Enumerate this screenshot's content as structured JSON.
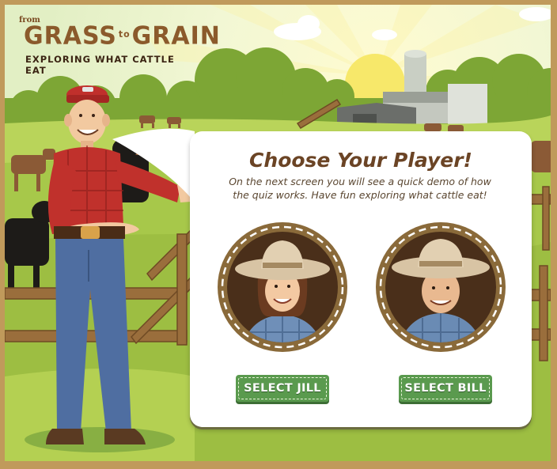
{
  "logo": {
    "from": "from",
    "word1": "GRASS",
    "to": "to",
    "word2": "GRAIN",
    "tagline": "Exploring What Cattle Eat"
  },
  "dialog": {
    "title": "Choose Your Player!",
    "description": "On the next screen you will see a quick demo of how the quiz works. Have fun exploring what cattle eat!"
  },
  "players": [
    {
      "name": "Jill",
      "button_label": "SELECT JILL"
    },
    {
      "name": "Bill",
      "button_label": "SELECT BILL"
    }
  ],
  "colors": {
    "sky": "#f4f8d8",
    "grass": "#a9c94a",
    "frame": "#c09a5b",
    "button": "#5a9a4e",
    "title": "#6b4425",
    "medallion_ring": "#8a6a3a"
  }
}
